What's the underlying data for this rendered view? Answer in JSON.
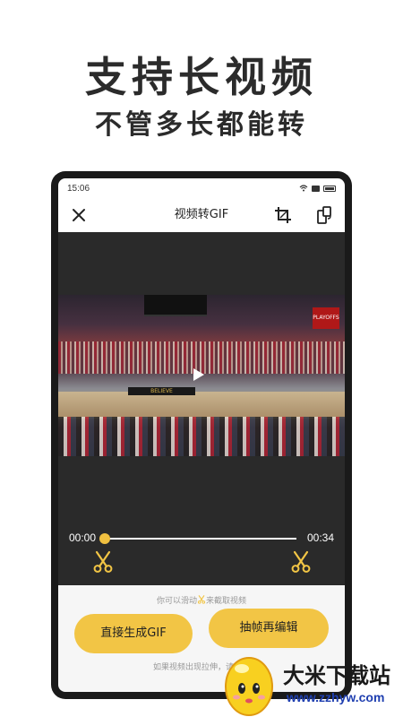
{
  "promo": {
    "headline": "支持长视频",
    "subline": "不管多长都能转"
  },
  "status_bar": {
    "time": "15:06"
  },
  "app_bar": {
    "title": "视频转GIF",
    "icons": [
      "close-icon",
      "crop-icon",
      "rotate-icon"
    ]
  },
  "video": {
    "banner_text": "BELIEVE",
    "sign_text": "PLAYOFFS"
  },
  "timeline": {
    "start": "00:00",
    "end": "00:34",
    "position": 0
  },
  "panel": {
    "hint": "你可以滑动",
    "hint_suffix": "来截取视频",
    "generate_gif_label": "直接生成GIF",
    "extract_frames_label": "抽帧再编辑",
    "note": "如果视频出现拉伸，请点击"
  },
  "watermark": {
    "name": "大米下载站",
    "url": "www.zzhyw.com"
  },
  "colors": {
    "accent": "#f2c545",
    "phone_frame": "#1a1a1a",
    "editor_bg": "#2a2a2a"
  }
}
